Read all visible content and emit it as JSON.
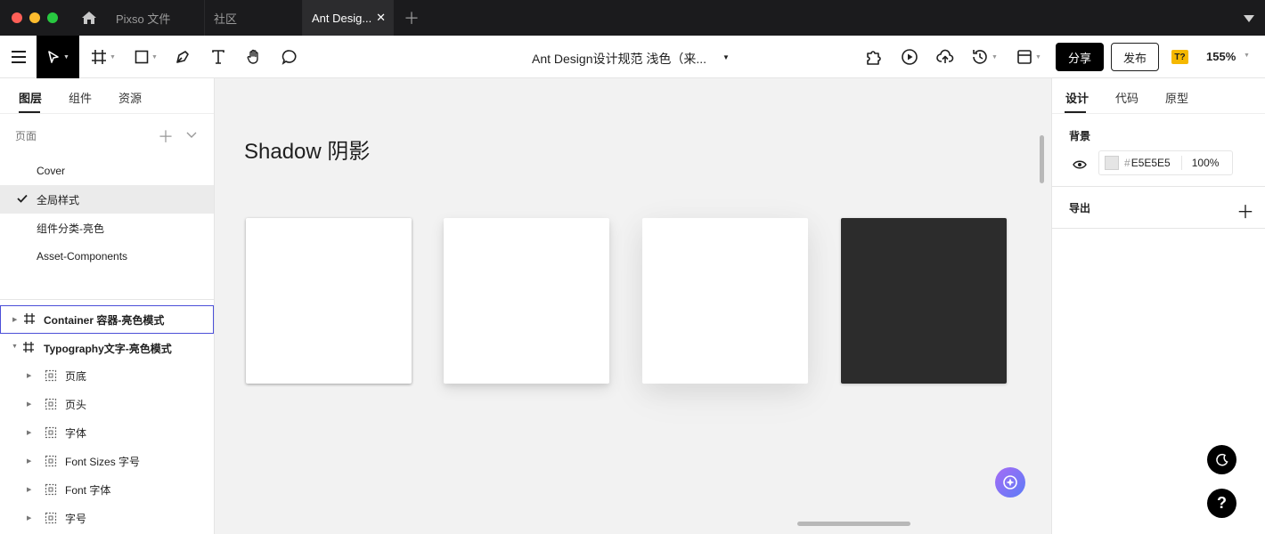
{
  "window": {
    "tabs": [
      {
        "label": "Pixso 文件"
      },
      {
        "label": "社区"
      },
      {
        "label": "Ant Desig..."
      }
    ]
  },
  "toolbar": {
    "file_title": "Ant Design设计规范 浅色（来...",
    "share_label": "分享",
    "publish_label": "发布",
    "badge_label": "T?",
    "zoom": "155%"
  },
  "left_panel": {
    "tabs": [
      "图层",
      "组件",
      "资源"
    ],
    "pages_header": "页面",
    "pages": [
      "Cover",
      "全局样式",
      "组件分类-亮色",
      "Asset-Components"
    ],
    "selected_page": "全局样式",
    "layers": [
      {
        "name": "Container 容器-亮色模式",
        "type": "frame",
        "expanded": false
      },
      {
        "name": "Typography文字-亮色模式",
        "type": "frame",
        "expanded": true
      },
      {
        "name": "页底",
        "type": "group"
      },
      {
        "name": "页头",
        "type": "group"
      },
      {
        "name": "字体",
        "type": "group"
      },
      {
        "name": "Font Sizes 字号",
        "type": "group"
      },
      {
        "name": "Font 字体",
        "type": "group"
      },
      {
        "name": "字号",
        "type": "group"
      }
    ]
  },
  "canvas": {
    "title": "Shadow 阴影"
  },
  "right_panel": {
    "tabs": [
      "设计",
      "代码",
      "原型"
    ],
    "background_label": "背景",
    "background_hex": "E5E5E5",
    "background_hash": "#",
    "background_opacity": "100%",
    "export_label": "导出",
    "help_label": "?"
  },
  "colors": {
    "accent": "#4b4fd8",
    "dark_card": "#2c2c2c",
    "badge": "#f5b800"
  }
}
